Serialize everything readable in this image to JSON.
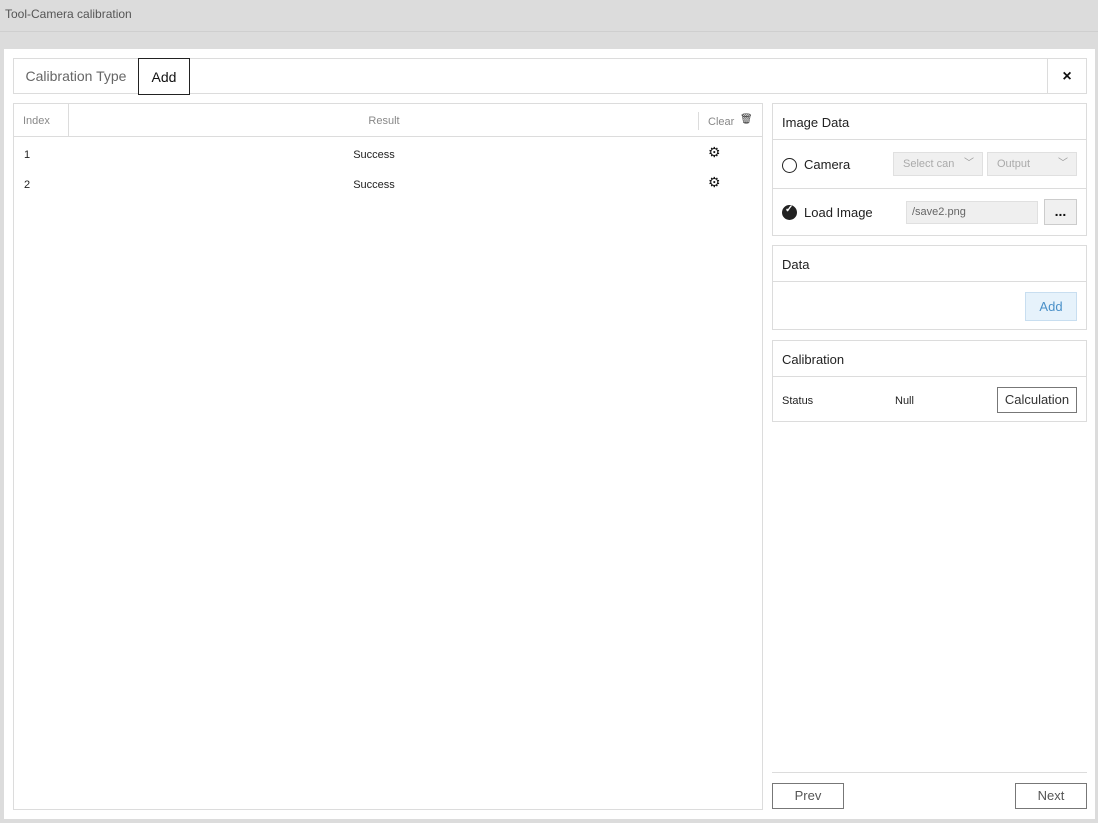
{
  "window": {
    "title": "Tool-Camera calibration"
  },
  "tabs": [
    {
      "label": "Calibration Type"
    },
    {
      "label": "Add"
    }
  ],
  "close_label": "×",
  "table": {
    "headers": {
      "index": "Index",
      "result": "Result",
      "clear": "Clear"
    },
    "rows": [
      {
        "index": "1",
        "result": "Success"
      },
      {
        "index": "2",
        "result": "Success"
      }
    ]
  },
  "image_data": {
    "title": "Image Data",
    "camera_label": "Camera",
    "camera_select": "Select can",
    "output_select": "Output",
    "load_image_label": "Load Image",
    "path_value": "/save2.png",
    "browse_label": "..."
  },
  "data_card": {
    "title": "Data",
    "add_label": "Add"
  },
  "calibration": {
    "title": "Calibration",
    "status_label": "Status",
    "status_value": "Null",
    "calc_label": "Calculation"
  },
  "footer": {
    "prev_label": "Prev",
    "next_label": "Next"
  },
  "colors": {
    "accent": "#4a90c8",
    "border": "#dcdcdc",
    "background": "#dcdcdc"
  },
  "icons": {
    "gear": "gear-icon",
    "trash": "trash-icon",
    "close": "close-icon"
  }
}
